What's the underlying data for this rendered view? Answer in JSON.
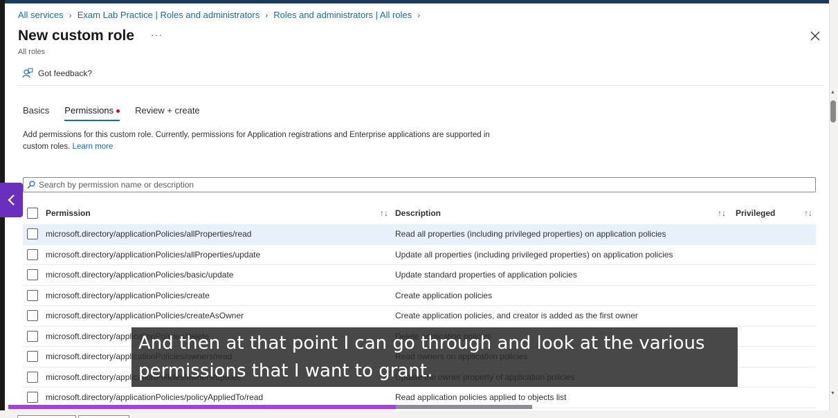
{
  "breadcrumb": [
    "All services",
    "Exam Lab Practice | Roles and administrators",
    "Roles and administrators | All roles"
  ],
  "header": {
    "title": "New custom role",
    "more_label": "···",
    "subtitle": "All roles"
  },
  "feedback_label": "Got feedback?",
  "tabs": [
    {
      "label": "Basics"
    },
    {
      "label": "Permissions"
    },
    {
      "label": "Review + create"
    }
  ],
  "description": {
    "text": "Add permissions for this custom role. Currently, permissions for Application registrations and Enterprise applications are supported in custom roles.",
    "link": "Learn more"
  },
  "search": {
    "placeholder": "Search by permission name or description"
  },
  "table": {
    "headers": {
      "permission": "Permission",
      "description": "Description",
      "privileged": "Privileged",
      "sort": "↑↓"
    },
    "rows": [
      {
        "permission": "microsoft.directory/applicationPolicies/allProperties/read",
        "description": "Read all properties (including privileged properties) on application policies"
      },
      {
        "permission": "microsoft.directory/applicationPolicies/allProperties/update",
        "description": "Update all properties (including privileged properties) on application policies"
      },
      {
        "permission": "microsoft.directory/applicationPolicies/basic/update",
        "description": "Update standard properties of application policies"
      },
      {
        "permission": "microsoft.directory/applicationPolicies/create",
        "description": "Create application policies"
      },
      {
        "permission": "microsoft.directory/applicationPolicies/createAsOwner",
        "description": "Create application policies, and creator is added as the first owner"
      },
      {
        "permission": "microsoft.directory/applicationPolicies/delete",
        "description": "Delete application policies"
      },
      {
        "permission": "microsoft.directory/applicationPolicies/owners/read",
        "description": "Read owners on application policies"
      },
      {
        "permission": "microsoft.directory/applicationPolicies/owners/update",
        "description": "Update the owner property of application policies"
      },
      {
        "permission": "microsoft.directory/applicationPolicies/policyAppliedTo/read",
        "description": "Read application policies applied to objects list"
      }
    ]
  },
  "caption": "And then at that point I can go through and look at the various permissions that I want to grant.",
  "video_progress": 0.74,
  "colors": {
    "accent": "#0f6cbd",
    "side_button": "#6b2fbd",
    "progress": "#a83bea",
    "selected_row": "#e8f1fb"
  }
}
